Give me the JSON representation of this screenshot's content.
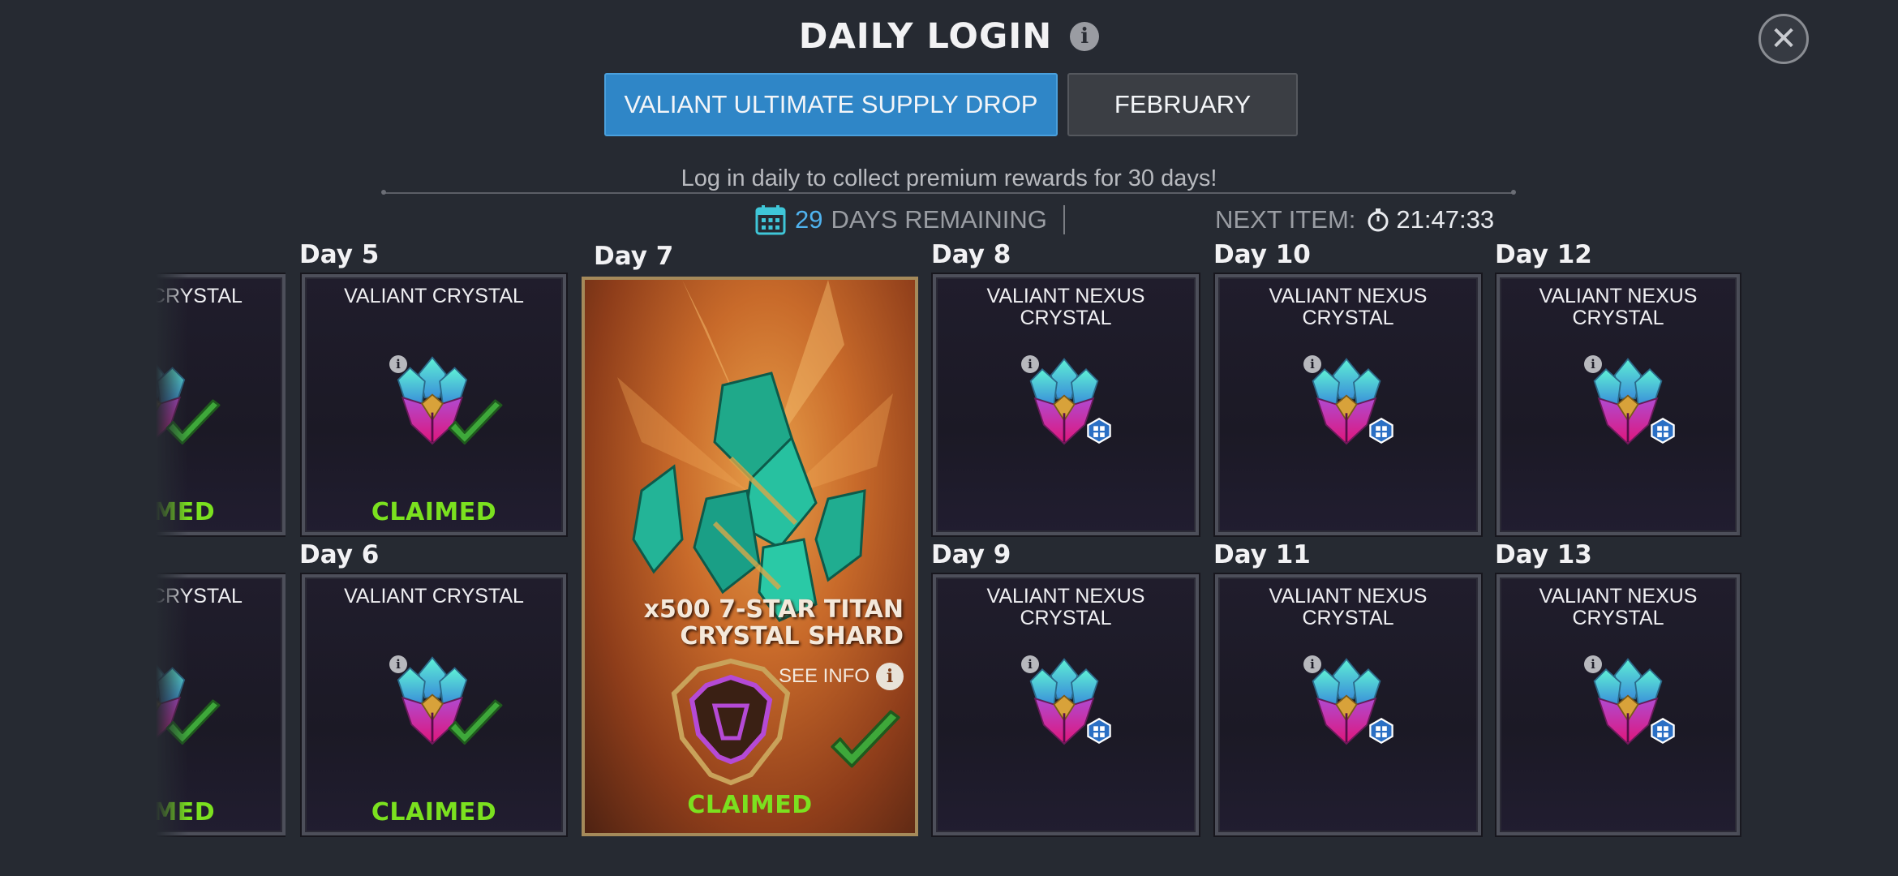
{
  "header": {
    "title": "DAILY LOGIN",
    "info_icon": "info-icon",
    "close_icon": "close-icon"
  },
  "tabs": [
    {
      "label": "VALIANT ULTIMATE SUPPLY DROP",
      "active": true
    },
    {
      "label": "FEBRUARY",
      "active": false
    }
  ],
  "subtitle": "Log in daily to collect premium rewards for 30 days!",
  "status": {
    "days_number": "29",
    "days_label": "DAYS REMAINING",
    "next_item_label": "NEXT ITEM:",
    "next_item_time": "21:47:33"
  },
  "rewards": {
    "partial_top": {
      "title": "VALIANT CRYSTAL",
      "status": "CLAIMED"
    },
    "partial_bottom": {
      "title": "VALIANT CRYSTAL",
      "status": "CLAIMED"
    },
    "day5": {
      "day": "Day 5",
      "title": "VALIANT CRYSTAL",
      "status": "CLAIMED"
    },
    "day6": {
      "day": "Day 6",
      "title": "VALIANT CRYSTAL",
      "status": "CLAIMED"
    },
    "day7": {
      "day": "Day 7",
      "title_line1": "x500 7-STAR TITAN",
      "title_line2": "CRYSTAL SHARD",
      "see_info": "SEE INFO",
      "status": "CLAIMED"
    },
    "day8": {
      "day": "Day 8",
      "title": "VALIANT NEXUS CRYSTAL"
    },
    "day9": {
      "day": "Day 9",
      "title": "VALIANT NEXUS CRYSTAL"
    },
    "day10": {
      "day": "Day 10",
      "title": "VALIANT NEXUS CRYSTAL"
    },
    "day11": {
      "day": "Day 11",
      "title": "VALIANT NEXUS CRYSTAL"
    },
    "day12": {
      "day": "Day 12",
      "title": "VALIANT NEXUS CRYSTAL"
    },
    "day13": {
      "day": "Day 13",
      "title": "VALIANT NEXUS CRYSTAL"
    }
  },
  "colors": {
    "accent_blue": "#2f86c7",
    "claimed_green": "#7be11f",
    "background": "#262a32"
  }
}
